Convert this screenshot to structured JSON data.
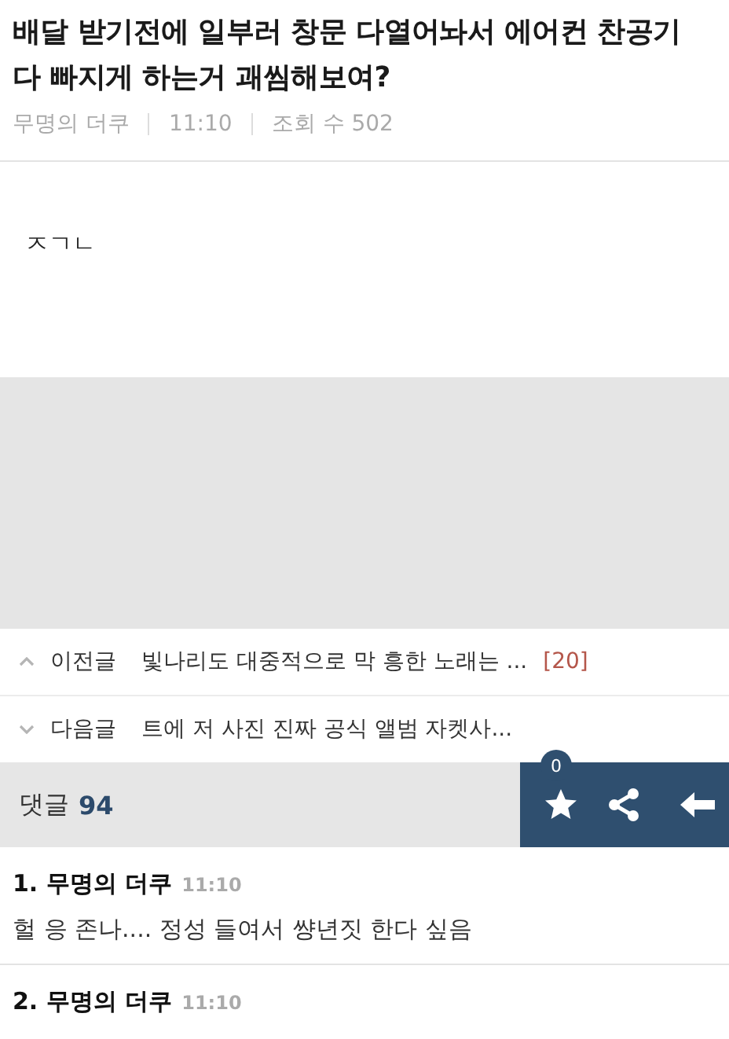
{
  "post": {
    "title": "배달 받기전에 일부러 창문 다열어놔서 에어컨 찬공기 다 빠지게 하는거 괘씸해보여?",
    "author": "무명의 더쿠",
    "time": "11:10",
    "views": "조회 수 502",
    "body": "ㅈㄱㄴ"
  },
  "nav": [
    {
      "kind": "prev",
      "label": "이전글",
      "title": "빛나리도 대중적으로 막 흥한 노래는 ...",
      "count": "[20]"
    },
    {
      "kind": "next",
      "label": "다음글",
      "title": "트에 저 사진 진짜 공식 앨범 자켓사..."
    }
  ],
  "comment_bar": {
    "label": "댓글",
    "count": "94",
    "star_count": "0"
  },
  "comments": [
    {
      "number": "1.",
      "author": "무명의 더쿠",
      "time": "11:10",
      "text": "헐 응 존나.... 정성 들여서 썅년짓 한다 싶음"
    },
    {
      "number": "2.",
      "author": "무명의 더쿠",
      "time": "11:10"
    }
  ]
}
